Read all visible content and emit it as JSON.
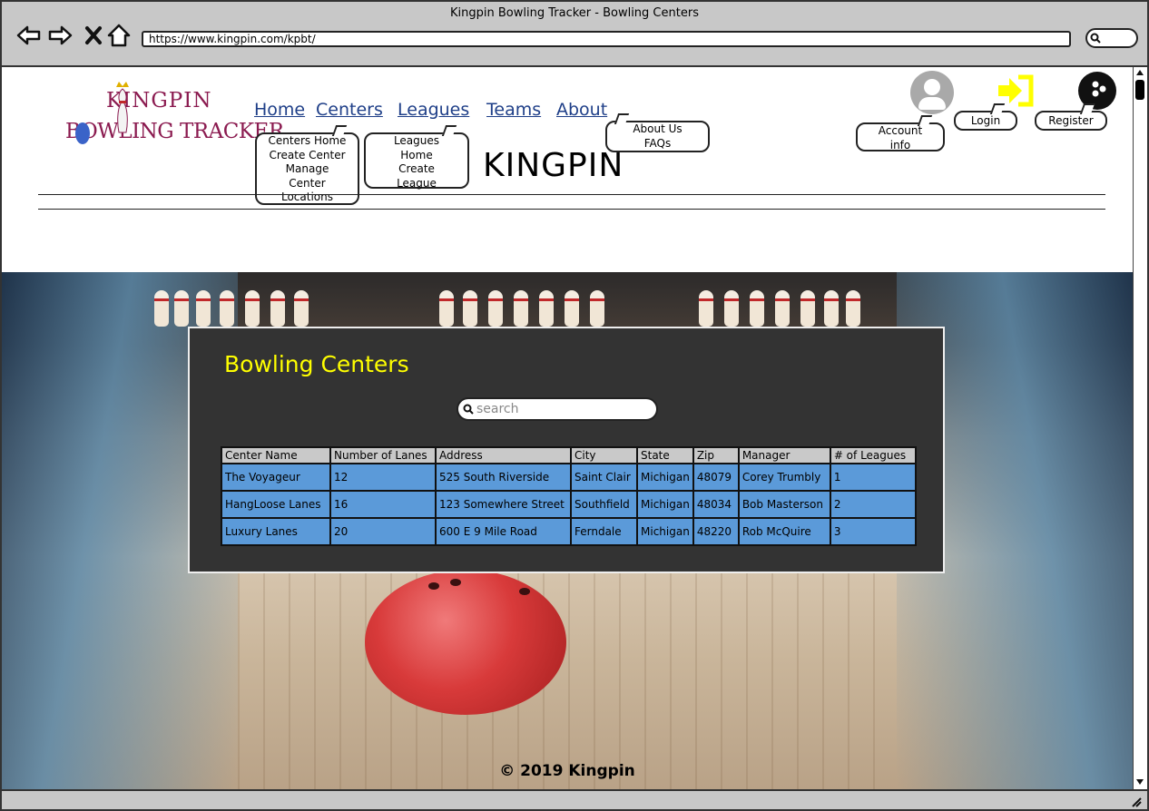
{
  "browser": {
    "window_title": "Kingpin Bowling Tracker - Bowling Centers",
    "url": "https://www.kingpin.com/kpbt/"
  },
  "logo": {
    "line1": "KINGPIN",
    "line2": "BOWLING TRACKER"
  },
  "nav": {
    "home": "Home",
    "centers": "Centers",
    "leagues": "Leagues",
    "teams": "Teams",
    "about": "About"
  },
  "submenus": {
    "centers": [
      "Centers Home",
      "Create Center",
      "Manage",
      "Center",
      "Locations"
    ],
    "leagues": [
      "Leagues",
      "Home",
      "Create",
      "League"
    ],
    "about": [
      "About Us",
      "FAQs"
    ]
  },
  "brand_text": "KINGPIN",
  "account": {
    "account_info": [
      "Account",
      "info"
    ],
    "login": "Login",
    "register": "Register"
  },
  "icons": {
    "account": "user-avatar-icon",
    "login": "login-arrow-icon",
    "register": "bowling-ball-icon"
  },
  "colors": {
    "panel_title": "#ffff00",
    "nav_link": "#1f3f88",
    "table_row": "#5b9ad9",
    "login_icon": "#ffff00"
  },
  "panel": {
    "title": "Bowling Centers",
    "search_placeholder": "search",
    "columns": [
      "Center Name",
      "Number of Lanes",
      "Address",
      "City",
      "State",
      "Zip",
      "Manager",
      "# of Leagues"
    ],
    "rows": [
      [
        "The Voyageur",
        "12",
        "525 South Riverside",
        "Saint Clair",
        "Michigan",
        "48079",
        "Corey Trumbly",
        "1"
      ],
      [
        "HangLoose Lanes",
        "16",
        "123 Somewhere Street",
        "Southfield",
        "Michigan",
        "48034",
        "Bob Masterson",
        "2"
      ],
      [
        "Luxury Lanes",
        "20",
        "600 E 9 Mile Road",
        "Ferndale",
        "Michigan",
        "48220",
        "Rob McQuire",
        "3"
      ]
    ]
  },
  "footer": "© 2019 Kingpin"
}
